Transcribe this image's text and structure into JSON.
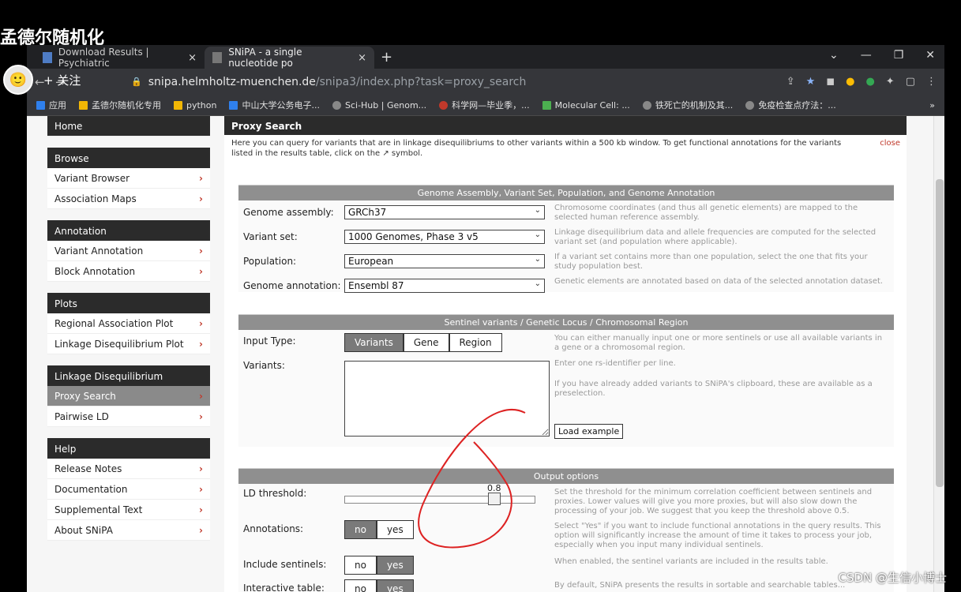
{
  "overlay": {
    "title": "孟德尔随机化",
    "follow": "+ 关注"
  },
  "browser": {
    "tabs": [
      {
        "label": "Download Results | Psychiatric"
      },
      {
        "label": "SNiPA - a single nucleotide po"
      }
    ],
    "url_host": "snipa.helmholtz-muenchen.de",
    "url_path": "/snipa3/index.php?task=proxy_search",
    "bookmarks": [
      "应用",
      "孟德尔随机化专用",
      "python",
      "中山大学公务电子...",
      "Sci-Hub | Genom...",
      "科学网—毕业季，...",
      "Molecular Cell: ...",
      "铁死亡的机制及其...",
      "免疫检查点疗法：..."
    ]
  },
  "sidebar": {
    "home": "Home",
    "browse": {
      "title": "Browse",
      "items": [
        "Variant Browser",
        "Association Maps"
      ]
    },
    "annotation": {
      "title": "Annotation",
      "items": [
        "Variant Annotation",
        "Block Annotation"
      ]
    },
    "plots": {
      "title": "Plots",
      "items": [
        "Regional Association Plot",
        "Linkage Disequilibrium Plot"
      ]
    },
    "ld": {
      "title": "Linkage Disequilibrium",
      "items": [
        "Proxy Search",
        "Pairwise LD"
      ]
    },
    "help": {
      "title": "Help",
      "items": [
        "Release Notes",
        "Documentation",
        "Supplemental Text",
        "About SNiPA"
      ]
    }
  },
  "main": {
    "title": "Proxy Search",
    "intro": "Here you can query for variants that are in linkage disequilibriums to other variants within a 500 kb window. To get functional annotations for the variants listed in the results table, click on the ↗ symbol.",
    "close": "close",
    "genome_section": {
      "title": "Genome Assembly, Variant Set, Population, and Genome Annotation",
      "rows": [
        {
          "label": "Genome assembly:",
          "value": "GRCh37",
          "help": "Chromosome coordinates (and thus all genetic elements) are mapped to the selected human reference assembly."
        },
        {
          "label": "Variant set:",
          "value": "1000 Genomes, Phase 3 v5",
          "help": "Linkage disequilibrium data and allele frequencies are computed for the selected variant set (and population where applicable)."
        },
        {
          "label": "Population:",
          "value": "European",
          "help": "If a variant set contains more than one population, select the one that fits your study population best."
        },
        {
          "label": "Genome annotation:",
          "value": "Ensembl 87",
          "help": "Genetic elements are annotated based on data of the selected annotation dataset."
        }
      ]
    },
    "sentinel_section": {
      "title": "Sentinel variants / Genetic Locus / Chromosomal Region",
      "input_type_label": "Input Type:",
      "input_types": [
        "Variants",
        "Gene",
        "Region"
      ],
      "input_type_help": "You can either manually input one or more sentinels or use all available variants in a gene or a chromosomal region.",
      "variants_label": "Variants:",
      "variants_help1": "Enter one rs-identifier per line.",
      "variants_help2": "If you have already added variants to SNiPA's clipboard, these are available as a preselection.",
      "load_example": "Load example"
    },
    "output_section": {
      "title": "Output options",
      "ld_label": "LD threshold:",
      "ld_value": "0.8",
      "ld_help": "Set the threshold for the minimum correlation coefficient between sentinels and proxies. Lower values will give you more proxies, but will also slow down the processing of your job. We suggest that you keep the threshold above 0.5.",
      "annotations_label": "Annotations:",
      "annotations_help": "Select \"Yes\" if you want to include functional annotations in the query results. This option will significantly increase the amount of time it takes to process your job, especially when you input many individual sentinels.",
      "include_label": "Include sentinels:",
      "include_help": "When enabled, the sentinel variants are included in the results table.",
      "interactive_label": "Interactive table:",
      "interactive_help": "By default, SNiPA presents the results in sortable and searchable tables...",
      "no": "no",
      "yes": "yes"
    }
  },
  "watermark": "CSDN @生信小博士"
}
